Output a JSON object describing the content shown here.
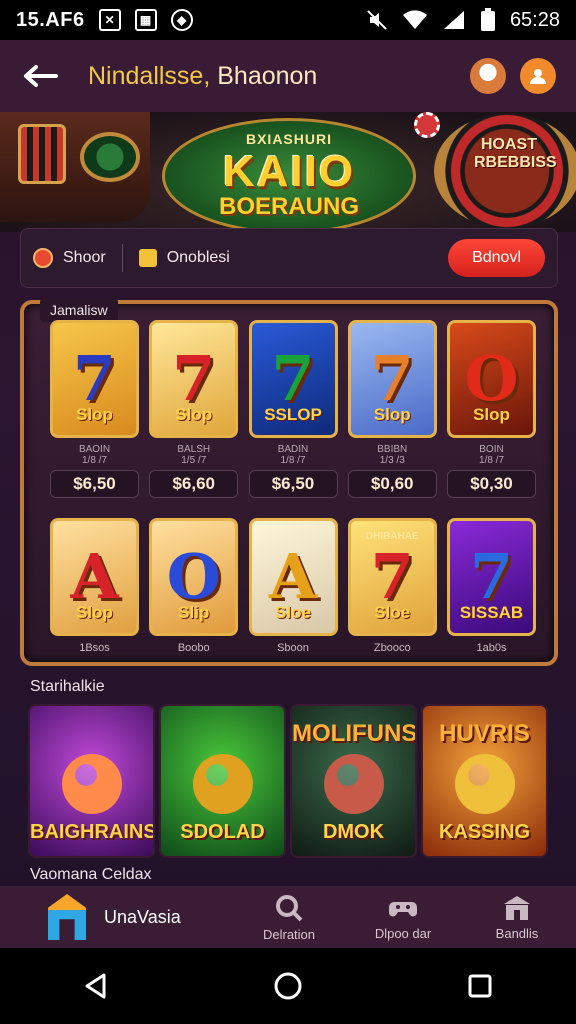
{
  "status_bar": {
    "time": "15.AF6",
    "clock": "65:28"
  },
  "header": {
    "title_main": "Nindallsse,",
    "title_accent": "Bhaonon"
  },
  "banner": {
    "logo_top": "BXIASHURI",
    "logo_main": "KAIIO",
    "logo_sub": "BOERAUNG",
    "roulette_text": "HOAST RBEBBISS"
  },
  "filter": {
    "item1": "Shoor",
    "item2": "Onoblesi",
    "button": "Bdnovl"
  },
  "section1": {
    "label": "Jamalisw"
  },
  "slots_row1": [
    {
      "top": "",
      "symbol": "7",
      "label": "Slop",
      "sym_color": "#2b3bbf",
      "bg": "linear-gradient(160deg,#f6c64a,#d88a1e)",
      "stat1": "BAOIN",
      "stat2": "1/8 /7",
      "price": "$6,50"
    },
    {
      "top": "",
      "symbol": "7",
      "label": "Slop",
      "sym_color": "#d8222a",
      "bg": "linear-gradient(160deg,#ffe79a,#e0a63a)",
      "stat1": "BALSH",
      "stat2": "1/5 /7",
      "price": "$6,60"
    },
    {
      "top": "",
      "symbol": "7",
      "label": "SSLOP",
      "sym_color": "#1aa23a",
      "bg": "linear-gradient(160deg,#2a5ad8,#0e2a7a)",
      "stat1": "BADIN",
      "stat2": "1/8 /7",
      "price": "$6,50"
    },
    {
      "top": "",
      "symbol": "7",
      "label": "Slop",
      "sym_color": "#e6802a",
      "bg": "linear-gradient(160deg,#9ab8f0,#4a6ac8)",
      "stat1": "BBIBN",
      "stat2": "1/3 /3",
      "price": "$0,60"
    },
    {
      "top": "",
      "symbol": "O",
      "label": "Slop",
      "sym_color": "#e22a1a",
      "bg": "linear-gradient(160deg,#d84a1a,#6a160a)",
      "stat1": "BOIN",
      "stat2": "1/8 /7",
      "price": "$0,30"
    }
  ],
  "slots_row2": [
    {
      "top": "",
      "symbol": "A",
      "label": "Slop",
      "sym_color": "#d8222a",
      "bg": "linear-gradient(160deg,#ffe0a0,#e0a040)",
      "caption": "1Bsos"
    },
    {
      "top": "",
      "symbol": "O",
      "label": "Slip",
      "sym_color": "#2a4ad8",
      "bg": "linear-gradient(160deg,#ffe0a0,#e09a3a)",
      "caption": "Boobo"
    },
    {
      "top": "",
      "symbol": "A",
      "label": "Sloe",
      "sym_color": "#e6a01a",
      "bg": "linear-gradient(160deg,#fff6d8,#d8c8a8)",
      "caption": "Sboon"
    },
    {
      "top": "DHIBAHAE",
      "symbol": "7",
      "label": "Sloe",
      "sym_color": "#d8222a",
      "bg": "linear-gradient(160deg,#ffe27a,#e0a23a)",
      "caption": "Zbooco"
    },
    {
      "top": "",
      "symbol": "7",
      "label": "SISSAB",
      "sym_color": "#2a6ae0",
      "bg": "linear-gradient(160deg,#8a2ad8,#3a0a7a)",
      "caption": "1ab0s"
    }
  ],
  "section2": {
    "label": "Starihalkie",
    "cards": [
      {
        "top": "",
        "text": "BAIGHRAINS",
        "bg": "radial-gradient(circle at 50% 40%,#c04ad8,#3a0a5a)",
        "face": "#ff8a4a"
      },
      {
        "top": "",
        "text": "SDOLAD",
        "bg": "radial-gradient(circle at 50% 40%,#4ac83a,#0e4a1a)",
        "face": "#e0a020"
      },
      {
        "top": "MOLIFUNS",
        "text": "DMOK",
        "bg": "radial-gradient(circle at 50% 40%,#3a6a4a,#101a14)",
        "face": "#c85a4a"
      },
      {
        "top": "HUVRIS",
        "text": "KASSING",
        "bg": "radial-gradient(circle at 50% 40%,#f2a23a,#8a2a0a)",
        "face": "#f0c03a"
      }
    ]
  },
  "section3": {
    "label": "Vaomana Celdax"
  },
  "bottom_nav": {
    "home_label": "UnaVasia",
    "item1": "Delration",
    "item2": "Dlpoo dar",
    "item3": "Bandlis"
  },
  "colors": {
    "accent_gold": "#f3c94a",
    "accent_red": "#e8342b",
    "panel_border": "#c07a3a"
  }
}
